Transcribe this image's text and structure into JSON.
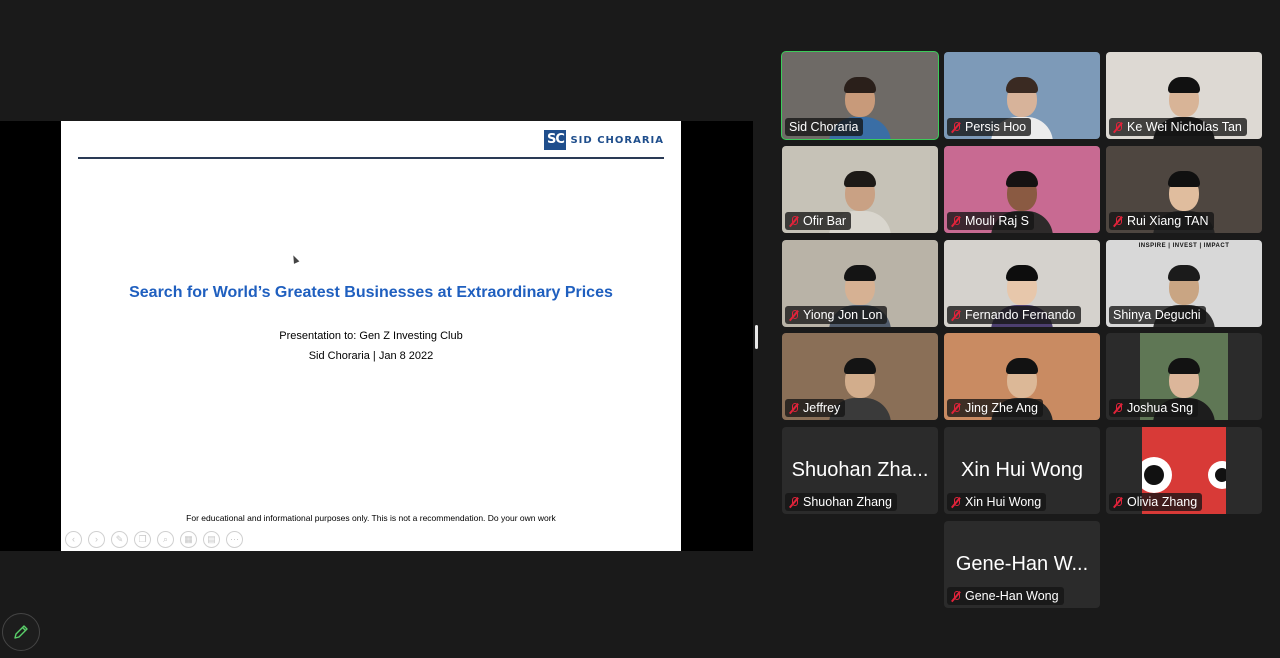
{
  "slide": {
    "logo_mark": "SC",
    "logo_text": "SID CHORARIA",
    "title": "Search for World’s Greatest Businesses at Extraordinary Prices",
    "subtitle1": "Presentation to: Gen Z Investing Club",
    "subtitle2": "Sid Choraria | Jan 8 2022",
    "footer": "For educational and informational purposes only. This is not a recommendation. Do your own work",
    "tool_icons": [
      "back-icon",
      "forward-icon",
      "pen-icon",
      "copy-icon",
      "zoom-icon",
      "grid-icon",
      "subtitle-icon",
      "more-icon"
    ]
  },
  "participants": [
    {
      "name": "Sid Choraria",
      "muted": false,
      "active": true,
      "video": true,
      "bg": "#6e6a66",
      "skin": "#c89a7a",
      "hair": "#2a1f1a",
      "shirt": "#3a6ea5"
    },
    {
      "name": "Persis Hoo",
      "muted": true,
      "video": true,
      "bg": "#7d9ab8",
      "skin": "#d7b39a",
      "hair": "#3a2a22",
      "shirt": "#ececec"
    },
    {
      "name": "Ke Wei Nicholas Tan",
      "muted": true,
      "video": true,
      "bg": "#ddd9d3",
      "skin": "#d8b497",
      "hair": "#111111",
      "shirt": "#1a1a1a"
    },
    {
      "name": "Ofir Bar",
      "muted": true,
      "video": true,
      "bg": "#c6c2b7",
      "skin": "#c9a184",
      "hair": "#1d1a17",
      "shirt": "#d9d6ce"
    },
    {
      "name": "Mouli Raj S",
      "muted": true,
      "video": true,
      "bg": "#c86a92",
      "skin": "#8a5a42",
      "hair": "#151212",
      "shirt": "#2d2a2a"
    },
    {
      "name": "Rui Xiang TAN",
      "muted": true,
      "video": true,
      "bg": "#4e4640",
      "skin": "#e0bd9e",
      "hair": "#101010",
      "shirt": "#242424"
    },
    {
      "name": "Yiong Jon Lon",
      "muted": true,
      "video": true,
      "bg": "#b9b3a7",
      "skin": "#d6b193",
      "hair": "#141414",
      "shirt": "#4f5a6a"
    },
    {
      "name": "Fernando Fernando",
      "muted": true,
      "video": true,
      "bg": "#d5d2cd",
      "skin": "#e7c7ab",
      "hair": "#0d0d0d",
      "shirt": "#4d3f70"
    },
    {
      "name": "Shinya Deguchi",
      "muted": false,
      "video": true,
      "poster": true,
      "poster_title": "INSPIRE | INVEST | IMPACT",
      "bg": "#d8d8d8",
      "skin": "#c9a583",
      "hair": "#1b1b1b",
      "shirt": "#2c2c2c"
    },
    {
      "name": "Jeffrey",
      "muted": true,
      "video": true,
      "bg": "#8a6f57",
      "skin": "#d2ad8c",
      "hair": "#141414",
      "shirt": "#3a3a3a"
    },
    {
      "name": "Jing Zhe Ang",
      "muted": true,
      "video": true,
      "bg": "#c98b62",
      "skin": "#dcb897",
      "hair": "#121212",
      "shirt": "#262626"
    },
    {
      "name": "Joshua Sng",
      "muted": true,
      "video": true,
      "narrow": true,
      "bg": "#5f7755",
      "skin": "#dcb69a",
      "hair": "#121212",
      "shirt": "#1d1d1d"
    },
    {
      "name": "Shuohan Zhang",
      "display": "Shuohan Zha...",
      "muted": true,
      "video": false
    },
    {
      "name": "Xin Hui Wong",
      "display": "Xin Hui Wong",
      "muted": true,
      "video": false
    },
    {
      "name": "Olivia Zhang",
      "muted": true,
      "video": true,
      "avatar_red": true,
      "bg": "#d83a37"
    },
    {
      "name": "Gene-Han Wong",
      "display": "Gene-Han W...",
      "muted": true,
      "video": false
    }
  ],
  "toolbar": {
    "edit_icon": "pencil-icon"
  }
}
